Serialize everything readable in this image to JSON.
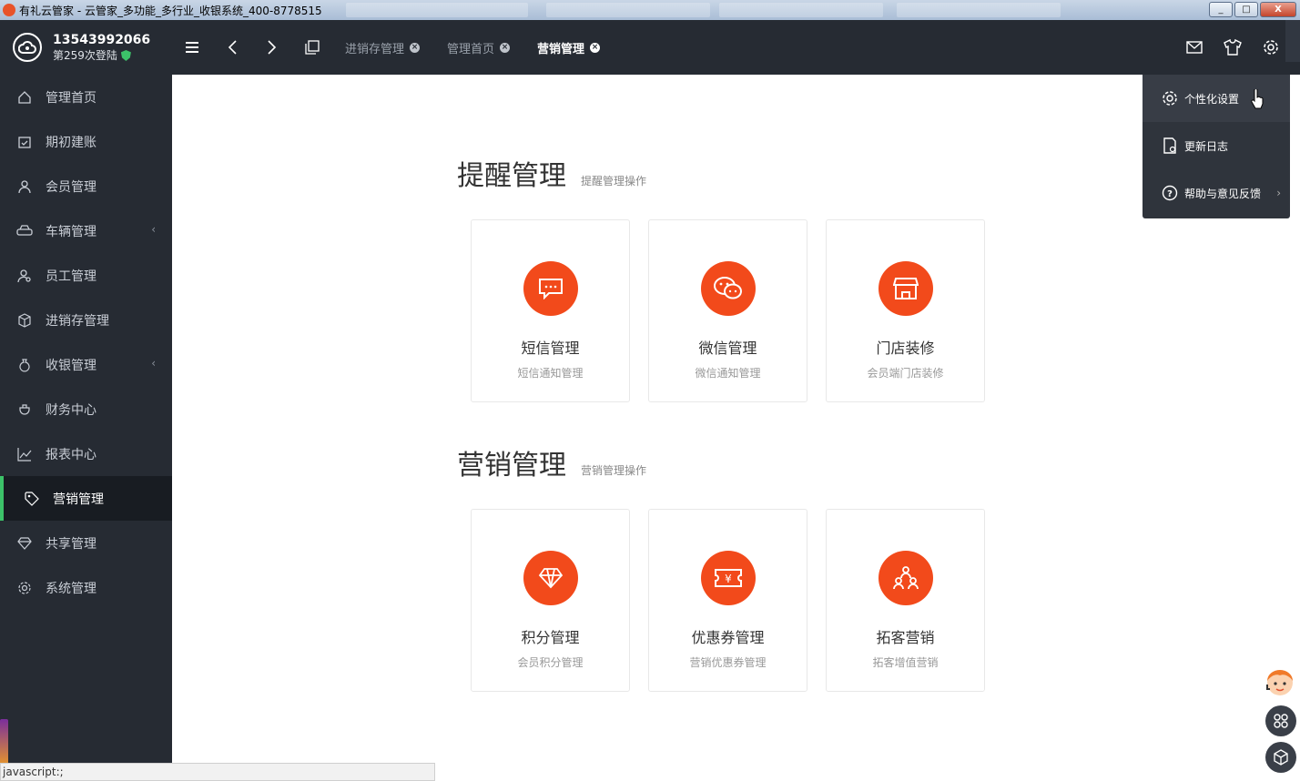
{
  "window": {
    "title": "有礼云管家 - 云管家_多功能_多行业_收银系统_400-8778515",
    "min": "_",
    "max": "□",
    "close": "X"
  },
  "user": {
    "phone": "13543992066",
    "logins": "第259次登陆"
  },
  "sidebar": {
    "items": [
      {
        "label": "管理首页",
        "icon": "home-icon"
      },
      {
        "label": "期初建账",
        "icon": "calendar-icon"
      },
      {
        "label": "会员管理",
        "icon": "user-icon"
      },
      {
        "label": "车辆管理",
        "icon": "car-icon",
        "arrow": "‹"
      },
      {
        "label": "员工管理",
        "icon": "staff-icon"
      },
      {
        "label": "进销存管理",
        "icon": "box-icon"
      },
      {
        "label": "收银管理",
        "icon": "money-bag-icon",
        "arrow": "‹"
      },
      {
        "label": "财务中心",
        "icon": "finance-icon"
      },
      {
        "label": "报表中心",
        "icon": "chart-icon"
      },
      {
        "label": "营销管理",
        "icon": "tag-icon",
        "active": true
      },
      {
        "label": "共享管理",
        "icon": "diamond-icon"
      },
      {
        "label": "系统管理",
        "icon": "gear-icon"
      }
    ]
  },
  "tabs": [
    {
      "label": "进销存管理"
    },
    {
      "label": "管理首页"
    },
    {
      "label": "营销管理",
      "active": true
    }
  ],
  "sections": [
    {
      "title": "提醒管理",
      "subtitle": "提醒管理操作",
      "cards": [
        {
          "name": "短信管理",
          "desc": "短信通知管理",
          "icon": "sms-icon"
        },
        {
          "name": "微信管理",
          "desc": "微信通知管理",
          "icon": "wechat-icon"
        },
        {
          "name": "门店装修",
          "desc": "会员端门店装修",
          "icon": "store-icon"
        }
      ]
    },
    {
      "title": "营销管理",
      "subtitle": "营销管理操作",
      "cards": [
        {
          "name": "积分管理",
          "desc": "会员积分管理",
          "icon": "diamond-icon"
        },
        {
          "name": "优惠券管理",
          "desc": "营销优惠券管理",
          "icon": "coupon-icon"
        },
        {
          "name": "拓客营销",
          "desc": "拓客增值营销",
          "icon": "people-icon"
        }
      ]
    }
  ],
  "dropdown": {
    "items": [
      {
        "label": "个性化设置",
        "icon": "gear-icon"
      },
      {
        "label": "更新日志",
        "icon": "document-icon"
      },
      {
        "label": "帮助与意见反馈",
        "icon": "help-icon",
        "arrow": "›"
      }
    ]
  },
  "status": "javascript:;",
  "colors": {
    "accent": "#f24a1b",
    "sidebar": "#262b33",
    "active_indicator": "#3cc269"
  }
}
